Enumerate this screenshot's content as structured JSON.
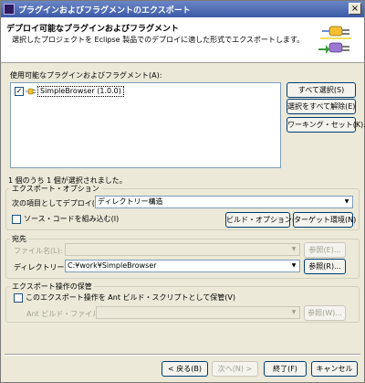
{
  "window": {
    "title": "プラグインおよびフラグメントのエクスポート",
    "close_label": "×"
  },
  "banner": {
    "title": "デプロイ可能なプラグインおよびフラグメント",
    "description": "選択したプロジェクトを Eclipse 製品でのデプロイに適した形式でエクスポートします。"
  },
  "available": {
    "label": "使用可能なプラグインおよびフラグメント(A):",
    "items": [
      {
        "label": "SimpleBrowser (1.0.0)",
        "checked": true,
        "check_glyph": "✓"
      }
    ],
    "buttons": {
      "select_all": "すべて選択(S)",
      "deselect_all": "選択をすべて解除(E)",
      "working_set": "ワーキング・セット(K)..."
    },
    "selection_status": "1 個のうち 1 個が選択されました。"
  },
  "export_options": {
    "group_label": "エクスポート・オプション",
    "deploy_as_label": "次の項目としてデプロイ(D):",
    "deploy_as_value": "ディレクトリー構造",
    "include_source_label": "ソース・コードを組み込む(I)",
    "include_source_checked": false,
    "build_options_button": "ビルド・オプション(U)",
    "target_env_button": "ターゲット環境(N)"
  },
  "destination": {
    "group_label": "宛先",
    "file_name_label": "ファイル名(L):",
    "file_name_value": "",
    "browse_file_button": "参照(E)...",
    "directory_label": "ディレクトリー(Y):",
    "directory_value": "C:¥work¥SimpleBrowser",
    "browse_dir_button": "参照(R)..."
  },
  "save_export": {
    "group_label": "エクスポート操作の保管",
    "save_as_ant_label": "このエクスポート操作を Ant ビルド・スクリプトとして保管(V)",
    "save_as_ant_checked": false,
    "ant_file_label": "Ant ビルド・ファイル(T):",
    "ant_file_value": "",
    "browse_ant_button": "参照(W)..."
  },
  "footer": {
    "back": "< 戻る(B)",
    "next": "次へ(N) >",
    "finish": "終了(F)",
    "cancel": "キャンセル"
  },
  "icons": {
    "plugin": "plug-icon",
    "banner": "plugin-export-icon",
    "dropdown": "▼"
  },
  "colors": {
    "title_bar": "#3c5aa8",
    "dialog_bg": "#ece9d8",
    "button_border": "#003c74",
    "disabled_text": "#a0a090"
  }
}
